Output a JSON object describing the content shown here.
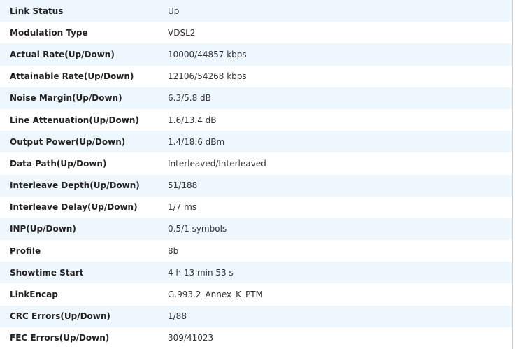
{
  "rows": [
    {
      "label": "Link Status",
      "value": "Up"
    },
    {
      "label": "Modulation Type",
      "value": "VDSL2"
    },
    {
      "label": "Actual Rate(Up/Down)",
      "value": "10000/44857 kbps"
    },
    {
      "label": "Attainable Rate(Up/Down)",
      "value": "12106/54268 kbps"
    },
    {
      "label": "Noise Margin(Up/Down)",
      "value": "6.3/5.8 dB"
    },
    {
      "label": "Line Attenuation(Up/Down)",
      "value": "1.6/13.4 dB"
    },
    {
      "label": "Output Power(Up/Down)",
      "value": "1.4/18.6 dBm"
    },
    {
      "label": "Data Path(Up/Down)",
      "value": "Interleaved/Interleaved"
    },
    {
      "label": "Interleave Depth(Up/Down)",
      "value": "51/188"
    },
    {
      "label": "Interleave Delay(Up/Down)",
      "value": "1/7 ms"
    },
    {
      "label": "INP(Up/Down)",
      "value": "0.5/1 symbols"
    },
    {
      "label": "Profile",
      "value": "8b"
    },
    {
      "label": "Showtime Start",
      "value": "4 h 13 min 53 s"
    },
    {
      "label": "LinkEncap",
      "value": "G.993.2_Annex_K_PTM"
    },
    {
      "label": "CRC Errors(Up/Down)",
      "value": "1/88"
    },
    {
      "label": "FEC Errors(Up/Down)",
      "value": "309/41023"
    }
  ]
}
